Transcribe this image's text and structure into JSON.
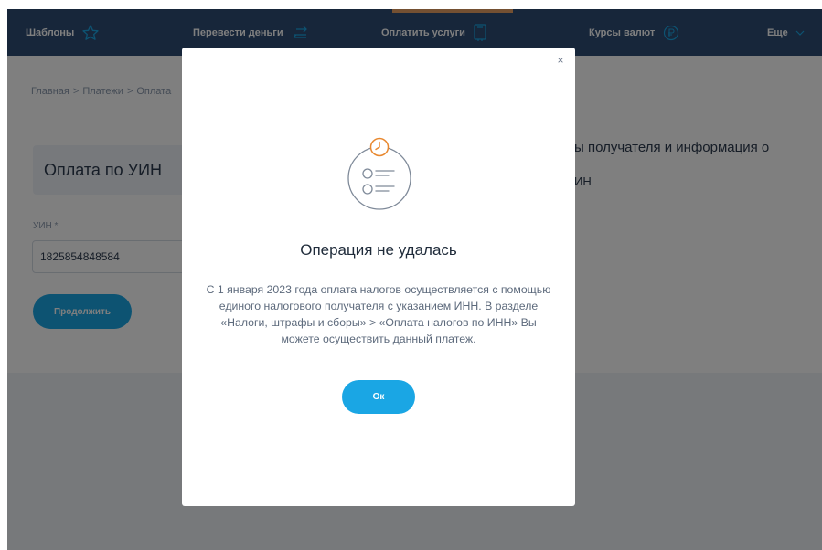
{
  "nav": {
    "templates_label": "Шаблоны",
    "transfer_label": "Перевести деньги",
    "pay_services_label": "Оплатить услуги",
    "rates_label": "Курсы валют",
    "more_label": "Еще",
    "bg_color": "#2f4c74",
    "active_accent": "#e8a165"
  },
  "breadcrumb": {
    "items": [
      "Главная",
      "Платежи",
      "Оплата"
    ],
    "separator": ">"
  },
  "page": {
    "card_title": "Оплата по УИН",
    "uin_label": "УИН *",
    "uin_value": "1825854848584",
    "continue_label": "Продолжить",
    "side_text_line1": "ы получателя и информация о",
    "side_text_line2": "ИН"
  },
  "modal": {
    "close_symbol": "×",
    "title": "Операция не удалась",
    "message": "С 1 января 2023 года оплата налогов осуществляется с помощью единого налогового получателя с указанием ИНН. В разделе «Налоги, штрафы и сборы» > «Оплата налогов по ИНН» Вы можете осуществить данный платеж.",
    "ok_label": "Ок",
    "accent_color": "#1aa6e4",
    "icon": "clock-list-icon"
  }
}
